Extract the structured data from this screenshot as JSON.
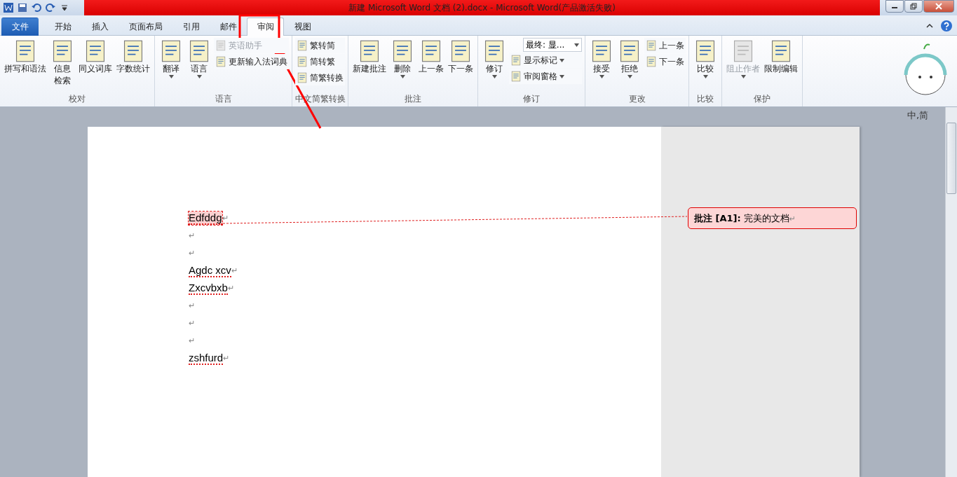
{
  "window": {
    "title": "新建 Microsoft Word 文档 (2).docx - Microsoft Word(产品激活失败)"
  },
  "tabs": [
    {
      "label": "文件",
      "kind": "file",
      "selected": false
    },
    {
      "label": "开始",
      "kind": "tab",
      "selected": false
    },
    {
      "label": "插入",
      "kind": "tab",
      "selected": false
    },
    {
      "label": "页面布局",
      "kind": "tab",
      "selected": false
    },
    {
      "label": "引用",
      "kind": "tab",
      "selected": false
    },
    {
      "label": "邮件",
      "kind": "tab",
      "selected": false
    },
    {
      "label": "审阅",
      "kind": "tab",
      "selected": true
    },
    {
      "label": "视图",
      "kind": "tab",
      "selected": false
    }
  ],
  "ribbon_groups": [
    {
      "label": "校对",
      "columns": [
        [
          {
            "kind": "large",
            "label": [
              "拼写和语法"
            ],
            "disabled": false,
            "dropdown": false
          }
        ],
        [
          {
            "kind": "large",
            "label": [
              "信息",
              "检索"
            ],
            "disabled": false,
            "dropdown": false
          }
        ],
        [
          {
            "kind": "large",
            "label": [
              "同义词库"
            ],
            "disabled": false,
            "dropdown": false
          }
        ],
        [
          {
            "kind": "large",
            "label": [
              "字数统计"
            ],
            "disabled": false,
            "dropdown": false
          }
        ]
      ]
    },
    {
      "label": "语言",
      "columns": [
        [
          {
            "kind": "large",
            "label": [
              "翻译"
            ],
            "disabled": false,
            "dropdown": true
          }
        ],
        [
          {
            "kind": "large",
            "label": [
              "语言"
            ],
            "disabled": false,
            "dropdown": true
          }
        ],
        [
          {
            "kind": "small",
            "label": [
              "英语助手"
            ],
            "disabled": true,
            "dropdown": false
          },
          {
            "kind": "small",
            "label": [
              "更新输入法词典"
            ],
            "disabled": false,
            "dropdown": false
          }
        ]
      ]
    },
    {
      "label": "中文简繁转换",
      "columns": [
        [
          {
            "kind": "small",
            "label": [
              "繁转简"
            ],
            "disabled": false,
            "dropdown": false
          },
          {
            "kind": "small",
            "label": [
              "简转繁"
            ],
            "disabled": false,
            "dropdown": false
          },
          {
            "kind": "small",
            "label": [
              "简繁转换"
            ],
            "disabled": false,
            "dropdown": false
          }
        ]
      ]
    },
    {
      "label": "批注",
      "columns": [
        [
          {
            "kind": "large",
            "label": [
              "新建批注"
            ],
            "disabled": false,
            "dropdown": false
          }
        ],
        [
          {
            "kind": "large",
            "label": [
              "删除"
            ],
            "disabled": false,
            "dropdown": true
          }
        ],
        [
          {
            "kind": "large",
            "label": [
              "上一条"
            ],
            "disabled": false,
            "dropdown": false
          }
        ],
        [
          {
            "kind": "large",
            "label": [
              "下一条"
            ],
            "disabled": false,
            "dropdown": false
          }
        ]
      ]
    },
    {
      "label": "修订",
      "columns": [
        [
          {
            "kind": "large",
            "label": [
              "修订"
            ],
            "disabled": false,
            "dropdown": true
          }
        ],
        [
          {
            "kind": "select",
            "label": [
              "最终: 显..."
            ],
            "disabled": false,
            "dropdown": true
          },
          {
            "kind": "small",
            "label": [
              "显示标记"
            ],
            "disabled": false,
            "dropdown": true
          },
          {
            "kind": "small",
            "label": [
              "审阅窗格"
            ],
            "disabled": false,
            "dropdown": true
          }
        ]
      ]
    },
    {
      "label": "更改",
      "columns": [
        [
          {
            "kind": "large",
            "label": [
              "接受"
            ],
            "disabled": false,
            "dropdown": true
          }
        ],
        [
          {
            "kind": "large",
            "label": [
              "拒绝"
            ],
            "disabled": false,
            "dropdown": true
          }
        ],
        [
          {
            "kind": "small",
            "label": [
              "上一条"
            ],
            "disabled": false,
            "dropdown": false
          },
          {
            "kind": "small",
            "label": [
              "下一条"
            ],
            "disabled": false,
            "dropdown": false
          }
        ]
      ]
    },
    {
      "label": "比较",
      "columns": [
        [
          {
            "kind": "large",
            "label": [
              "比较"
            ],
            "disabled": false,
            "dropdown": true
          }
        ]
      ]
    },
    {
      "label": "保护",
      "columns": [
        [
          {
            "kind": "large",
            "label": [
              "阻止作者"
            ],
            "disabled": true,
            "dropdown": true
          }
        ],
        [
          {
            "kind": "large",
            "label": [
              "限制编辑"
            ],
            "disabled": false,
            "dropdown": false
          }
        ]
      ]
    }
  ],
  "ime_badge": {
    "text": "中,简"
  },
  "document": {
    "paragraphs": [
      {
        "text": "Edfddg",
        "mark": "↵",
        "misspelled": true,
        "commented": true
      },
      {
        "mark": "↵"
      },
      {
        "mark": "↵"
      },
      {
        "text": "Agdc xcv",
        "mark": "↵",
        "misspelled": true,
        "commented": false
      },
      {
        "text": "Zxcvbxb",
        "mark": "↵",
        "misspelled": true,
        "commented": false
      },
      {
        "mark": "↵"
      },
      {
        "mark": "↵"
      },
      {
        "mark": "↵"
      },
      {
        "text": "zshfurd",
        "mark": "↵",
        "misspelled": true,
        "commented": false
      }
    ]
  },
  "comment": {
    "label": "批注 [A1]:",
    "text": "完美的文档",
    "mark": "↵"
  }
}
